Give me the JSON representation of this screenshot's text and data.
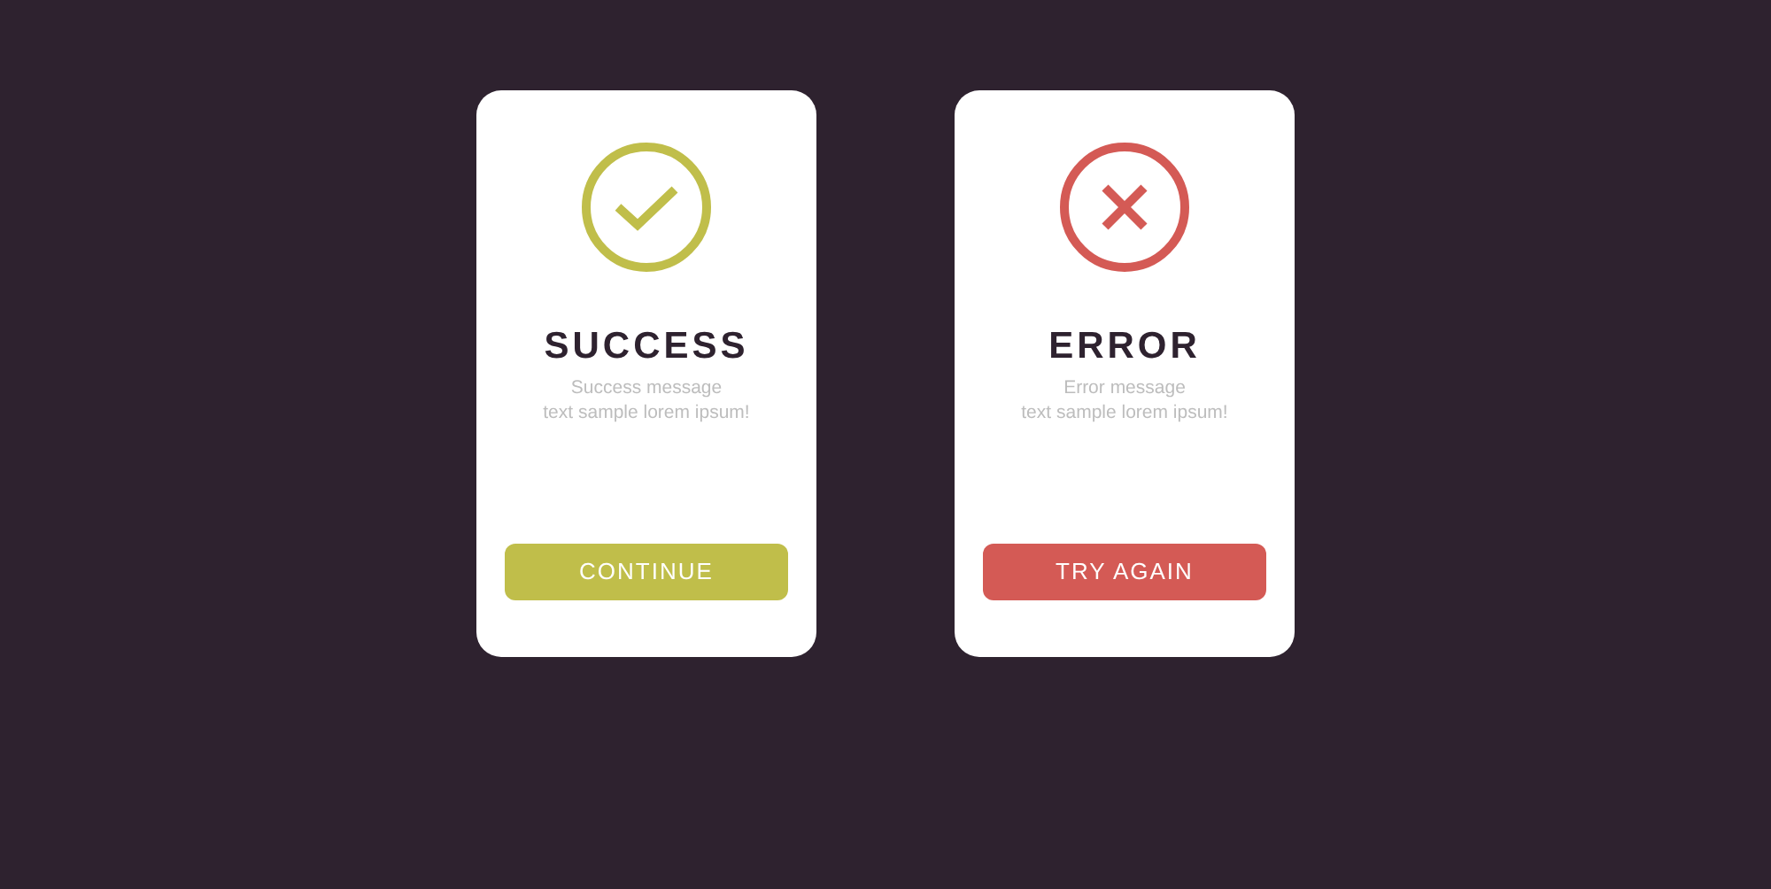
{
  "cards": [
    {
      "kind": "success",
      "color": "#c0be4a",
      "title": "SUCCESS",
      "message": "Success message\ntext sample lorem ipsum!",
      "button": "CONTINUE"
    },
    {
      "kind": "error",
      "color": "#d45a55",
      "title": "ERROR",
      "message": "Error message\ntext sample lorem ipsum!",
      "button": "TRY AGAIN"
    }
  ]
}
